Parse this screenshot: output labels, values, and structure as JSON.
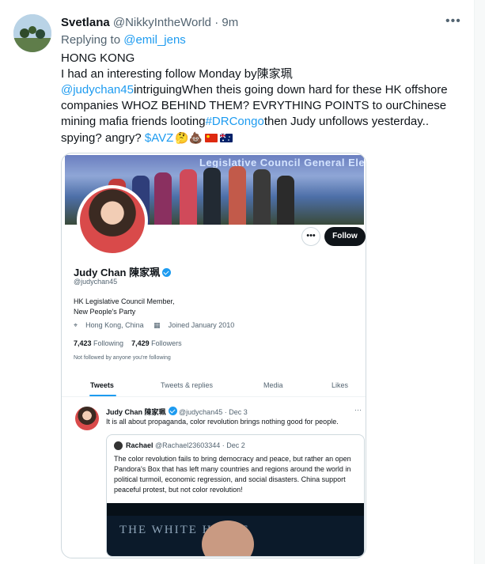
{
  "tweet": {
    "author_name": "Svetlana",
    "author_handle": "@NikkyIntheWorld",
    "separator": "·",
    "time": "9m",
    "replying_prefix": "Replying to",
    "replying_handle": "@emil_jens",
    "line1": "HONG KONG",
    "line2": "I had an interesting follow Monday by陳家珮",
    "line3_mention": "@judychan45",
    "line3_rest": "intriguingWhen theis going down hard for these HK offshore",
    "line4": "companies WHOZ BEHIND THEM? EVRYTHING POINTS to ourChinese",
    "line5_pre": "mining mafia friends looting",
    "line5_hashtag": "#DRCongo",
    "line5_post": "then Judy unfollows yesterday..",
    "line6_pre": "spying? angry?",
    "line6_cashtag": "$AVZ",
    "line6_emojis": "🤔💩",
    "more_icon": "more-dots-icon",
    "colors": {
      "link": "#1d9bf0",
      "muted": "#536471",
      "text": "#0f1419"
    }
  },
  "profile_card": {
    "banner_text": "Legislative Council General Election",
    "more_label": "•••",
    "follow_label": "Follow",
    "name": "Judy Chan 陳家珮",
    "handle": "@judychan45",
    "bio_line1": "HK Legislative Council Member,",
    "bio_line2": "New People's Party",
    "location": "Hong Kong, China",
    "joined": "Joined January 2010",
    "following_count": "7,423",
    "following_label": "Following",
    "followers_count": "7,429",
    "followers_label": "Followers",
    "not_followed": "Not followed by anyone you're following",
    "tabs": [
      {
        "label": "Tweets"
      },
      {
        "label": "Tweets & replies"
      },
      {
        "label": "Media"
      },
      {
        "label": "Likes"
      }
    ],
    "inner_tweet": {
      "name": "Judy Chan 陳家珮",
      "handle": "@judychan45",
      "time": "Dec 3",
      "text": "It is all about propaganda, color revolution brings nothing good for people.",
      "more_label": "···"
    },
    "quote": {
      "name": "Rachael",
      "handle": "@Rachael23603344",
      "time": "Dec 2",
      "text": "The color revolution fails to bring democracy and peace, but rather an open Pandora's Box that has left many countries and regions around the world in political turmoil, economic regression, and social disasters. China support peaceful protest, but not color revolution!",
      "image_text": "THE WHITE HOUSE"
    }
  }
}
